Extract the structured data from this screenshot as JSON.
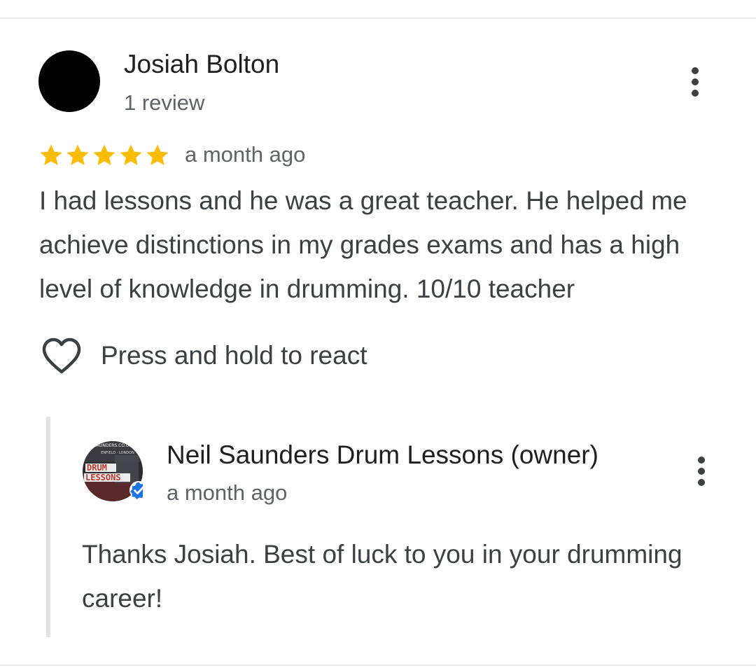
{
  "review": {
    "reviewer_name": "Josiah Bolton",
    "reviewer_meta": "1 review",
    "rating": 5,
    "rating_max": 5,
    "date": "a month ago",
    "text": "I had lessons and he was a great teacher. He helped me achieve distinctions in my grades exams and has a high level of knowledge in drumming. 10/10 teacher",
    "react_label": "Press and hold to react",
    "more_icon": "more-vert-icon",
    "react_icon": "heart-outline-icon"
  },
  "owner_reply": {
    "name": "Neil Saunders Drum Lessons (owner)",
    "date": "a month ago",
    "text": "Thanks Josiah. Best of luck to you in your drumming career!",
    "avatar_logo_lines": [
      "SAUNDERS.CO.UK",
      "ENFIELD · LONDON",
      "DRUM",
      "LESSONS"
    ],
    "verified_icon": "verified-badge-icon",
    "more_icon": "more-vert-icon"
  },
  "colors": {
    "star": "#fbbc04",
    "verified": "#1a73e8",
    "text_primary": "#1f1f1f",
    "text_secondary": "#5f6368"
  }
}
